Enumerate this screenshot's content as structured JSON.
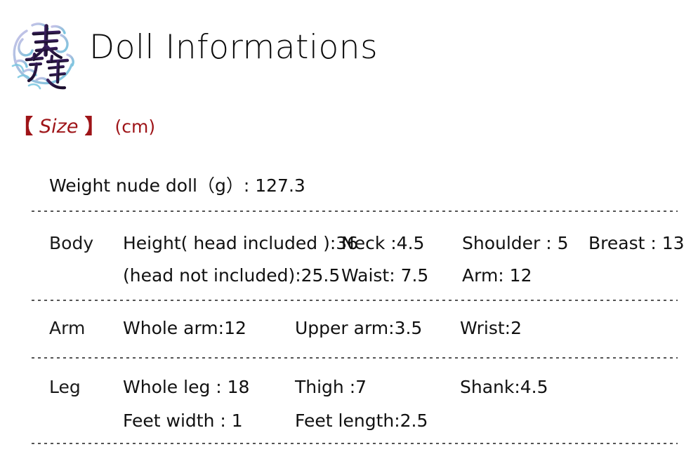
{
  "header": {
    "title": "Doll Informations",
    "logo": {
      "name": "dongfangyun-calligraphy-logo",
      "characters": "東方韵",
      "colors": {
        "ink": "#2d1b4e",
        "cloud_light": "#b9b7e0",
        "cloud_mid": "#8fb6d9",
        "wave": "#7fc4dd"
      }
    }
  },
  "size_heading": {
    "bracket_left": "【",
    "label": "Size",
    "bracket_right": "】",
    "unit": "(cm)",
    "color": "#9e1418"
  },
  "spec_rows": {
    "weight": {
      "text": "Weight  nude doll（g）: 127.3"
    },
    "body": {
      "label": "Body",
      "height_with_head": "Height( head included ):36",
      "height_without_head": "(head not included):25.5",
      "neck": "Neck :4.5",
      "waist": "Waist: 7.5",
      "shoulder": "Shoulder : 5",
      "arm": "Arm: 12",
      "breast": "Breast : 13"
    },
    "arm": {
      "label": "Arm",
      "whole_arm": "Whole arm:12",
      "upper_arm": "Upper arm:3.5",
      "wrist": "Wrist:2"
    },
    "leg": {
      "label": "Leg",
      "whole_leg": "Whole leg : 18",
      "thigh": "Thigh :7",
      "shank": "Shank:4.5",
      "feet_width": "Feet width : 1",
      "feet_length": "Feet length:2.5"
    }
  }
}
